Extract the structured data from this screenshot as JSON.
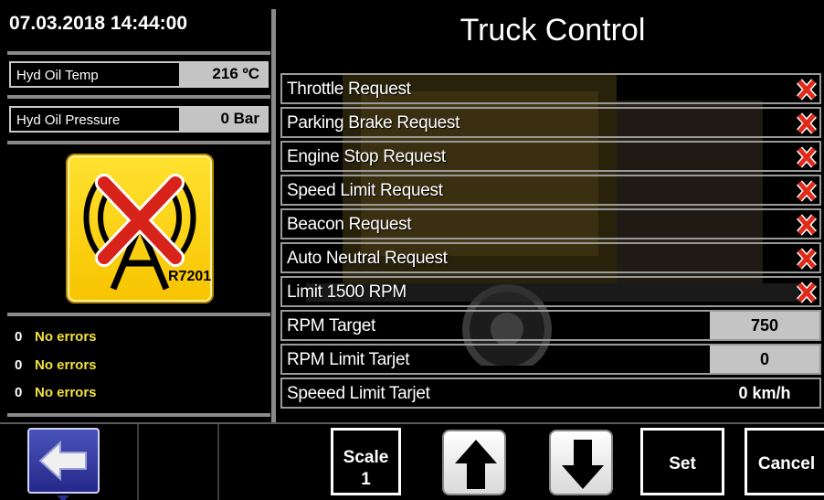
{
  "header": {
    "datetime": "07.03.2018 14:44:00",
    "title": "Truck Control"
  },
  "sensors": [
    {
      "label": "Hyd Oil Temp",
      "value": "216 ºC"
    },
    {
      "label": "Hyd Oil Pressure",
      "value": "0 Bar"
    }
  ],
  "radio": {
    "icon": "radio-tower-disconnected-icon",
    "label": "R7201",
    "color": "#f7c400"
  },
  "errors": [
    {
      "count": "0",
      "message": "No errors"
    },
    {
      "count": "0",
      "message": "No errors"
    },
    {
      "count": "0",
      "message": "No errors"
    }
  ],
  "requests": [
    {
      "label": "Throttle Request",
      "status_icon": "red-x-icon"
    },
    {
      "label": "Parking Brake Request",
      "status_icon": "red-x-icon"
    },
    {
      "label": "Engine Stop Request",
      "status_icon": "red-x-icon"
    },
    {
      "label": "Speed Limit Request",
      "status_icon": "red-x-icon"
    },
    {
      "label": "Beacon Request",
      "status_icon": "red-x-icon"
    },
    {
      "label": "Auto Neutral Request",
      "status_icon": "red-x-icon"
    },
    {
      "label": "Limit 1500 RPM",
      "status_icon": "red-x-icon"
    }
  ],
  "values": [
    {
      "label": "RPM Target",
      "value": "750"
    },
    {
      "label": "RPM Limit Tarjet",
      "value": "0"
    },
    {
      "label": "Speeed Limit Tarjet",
      "value": "0 km/h"
    }
  ],
  "toolbar": {
    "back_icon": "arrow-left-icon",
    "scale_label": "Scale",
    "scale_value": "1",
    "up_icon": "arrow-up-icon",
    "down_icon": "arrow-down-icon",
    "set_label": "Set",
    "cancel_label": "Cancel"
  },
  "colors": {
    "accent_yellow": "#f3e23a",
    "status_red": "#e02a1a",
    "back_button_blue": "#2f38a0"
  }
}
